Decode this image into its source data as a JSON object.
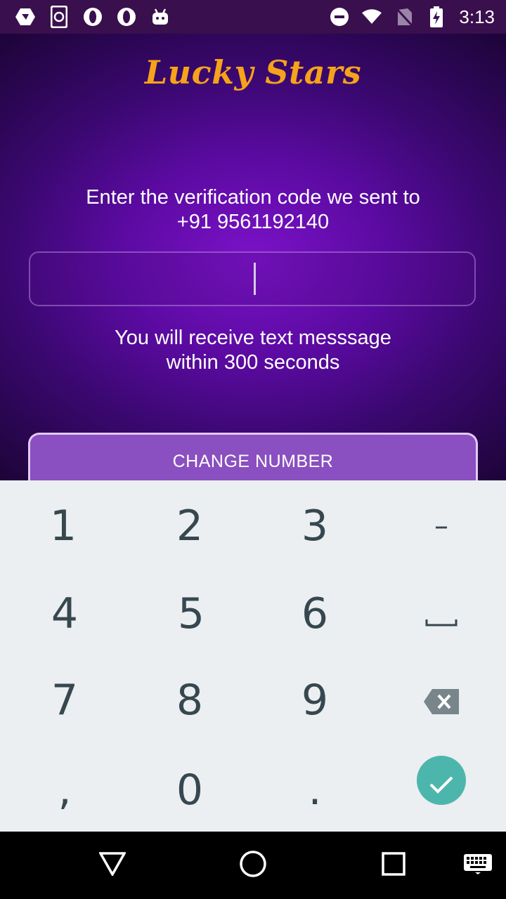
{
  "status_bar": {
    "time": "3:13",
    "icons_left": [
      "launcher-icon",
      "phone-sync-icon",
      "opera-icon",
      "opera-icon",
      "android-icon"
    ],
    "icons_right": [
      "do-not-disturb-icon",
      "wifi-icon",
      "no-sim-icon",
      "battery-charging-icon"
    ]
  },
  "app": {
    "logo": "Lucky Stars",
    "prompt_line1": "Enter the verification code we sent to",
    "prompt_line2": "+91 9561192140",
    "code_value": "",
    "hint_line1": "You will receive text messsage",
    "hint_line2": "within 300 seconds",
    "change_number_label": "CHANGE NUMBER",
    "colors": {
      "logo": "#f7a21b",
      "button": "#8a4fc0",
      "accent_check": "#4db6ac"
    }
  },
  "keyboard": {
    "row1": [
      "1",
      "2",
      "3",
      "–"
    ],
    "row2": [
      "4",
      "5",
      "6"
    ],
    "row3": [
      "7",
      "8",
      "9"
    ],
    "row4": [
      ",",
      "0",
      "."
    ]
  },
  "nav_bar": {
    "icons": [
      "back-icon",
      "home-icon",
      "recents-icon",
      "keyboard-icon"
    ]
  }
}
